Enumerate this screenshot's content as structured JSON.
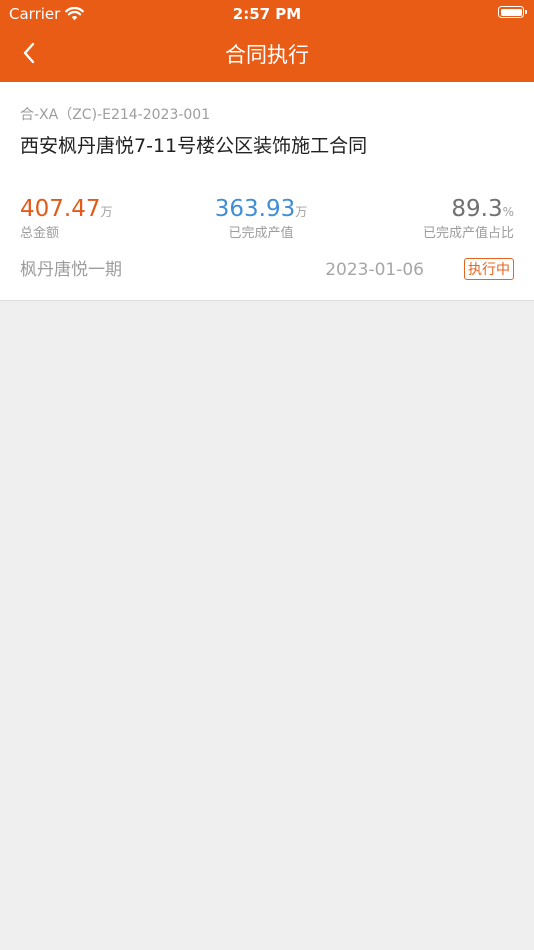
{
  "status_bar": {
    "carrier": "Carrier",
    "time": "2:57 PM"
  },
  "nav": {
    "title": "合同执行"
  },
  "contract": {
    "code": "合-XA（ZC)-E214-2023-001",
    "name": "西安枫丹唐悦7-11号楼公区装饰施工合同",
    "stats": {
      "total": {
        "value": "407.47",
        "unit": "万",
        "label": "总金额"
      },
      "completed": {
        "value": "363.93",
        "unit": "万",
        "label": "已完成产值"
      },
      "ratio": {
        "value": "89.3",
        "unit": "%",
        "label": "已完成产值占比"
      }
    },
    "project": "枫丹唐悦一期",
    "date": "2023-01-06",
    "status": "执行中"
  },
  "colors": {
    "brand": "#e85c16",
    "total_value": "#e45a19",
    "completed_value": "#3f8ed6",
    "ratio_value": "#707070",
    "background": "#efefef"
  },
  "icons": {
    "back": "chevron-left-icon",
    "wifi": "wifi-icon",
    "battery": "battery-icon"
  }
}
